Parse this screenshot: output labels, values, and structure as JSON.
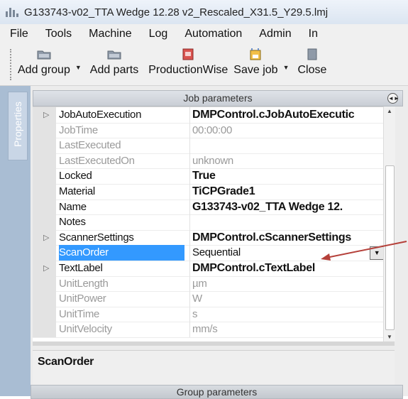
{
  "window": {
    "title": "G133743-v02_TTA Wedge 12.28 v2_Rescaled_X31.5_Y29.5.lmj"
  },
  "menu": [
    "File",
    "Tools",
    "Machine",
    "Log",
    "Automation",
    "Admin",
    "In"
  ],
  "toolbar": {
    "items": [
      {
        "label": "Add group",
        "icon": "folder-add-icon",
        "has_dropdown": true
      },
      {
        "label": "Add parts",
        "icon": "folder-add-icon",
        "has_dropdown": false
      },
      {
        "label": "ProductionWise",
        "icon": "productionwise-icon",
        "has_dropdown": false
      },
      {
        "label": "Save job",
        "icon": "save-job-icon",
        "has_dropdown": true
      },
      {
        "label": "Close",
        "icon": "close-job-icon",
        "has_dropdown": false
      }
    ]
  },
  "sidebar": {
    "tab_label": "Properties"
  },
  "panel": {
    "header": "Job parameters",
    "properties": [
      {
        "name": "JobAutoExecution",
        "value": "DMPControl.cJobAutoExecutic",
        "expandable": true,
        "bold": true,
        "muted": false
      },
      {
        "name": "JobTime",
        "value": "00:00:00",
        "expandable": false,
        "bold": false,
        "muted": true
      },
      {
        "name": "LastExecuted",
        "value": "",
        "expandable": false,
        "bold": false,
        "muted": true
      },
      {
        "name": "LastExecutedOn",
        "value": "unknown",
        "expandable": false,
        "bold": false,
        "muted": true
      },
      {
        "name": "Locked",
        "value": "True",
        "expandable": false,
        "bold": true,
        "muted": false
      },
      {
        "name": "Material",
        "value": "TiCPGrade1",
        "expandable": false,
        "bold": true,
        "muted": false
      },
      {
        "name": "Name",
        "value": "G133743-v02_TTA Wedge 12.",
        "expandable": false,
        "bold": true,
        "muted": false
      },
      {
        "name": "Notes",
        "value": "",
        "expandable": false,
        "bold": false,
        "muted": false
      },
      {
        "name": "ScannerSettings",
        "value": "DMPControl.cScannerSettings",
        "expandable": true,
        "bold": true,
        "muted": false
      },
      {
        "name": "ScanOrder",
        "value": "Sequential",
        "expandable": false,
        "bold": false,
        "muted": false,
        "selected": true
      },
      {
        "name": "TextLabel",
        "value": "DMPControl.cTextLabel",
        "expandable": true,
        "bold": true,
        "muted": false
      },
      {
        "name": "UnitLength",
        "value": "µm",
        "expandable": false,
        "bold": false,
        "muted": true
      },
      {
        "name": "UnitPower",
        "value": "W",
        "expandable": false,
        "bold": false,
        "muted": true
      },
      {
        "name": "UnitTime",
        "value": "s",
        "expandable": false,
        "bold": false,
        "muted": true
      },
      {
        "name": "UnitVelocity",
        "value": "mm/s",
        "expandable": false,
        "bold": false,
        "muted": true
      }
    ],
    "description_title": "ScanOrder",
    "group_header": "Group parameters"
  },
  "colors": {
    "selection": "#3399ff",
    "annotation_arrow": "#b5403a",
    "sidebar": "#a9bdd3"
  }
}
